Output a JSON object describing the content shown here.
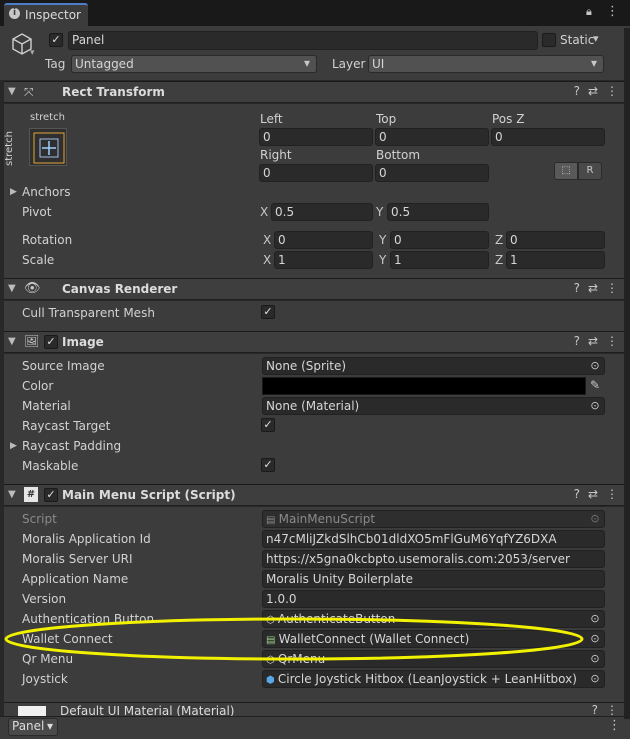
{
  "tab": {
    "title": "Inspector"
  },
  "object": {
    "name": "Panel",
    "static_label": "Static",
    "tag_label": "Tag",
    "tag_value": "Untagged",
    "layer_label": "Layer",
    "layer_value": "UI"
  },
  "rect_transform": {
    "title": "Rect Transform",
    "stretch_top": "stretch",
    "stretch_side": "stretch",
    "left_label": "Left",
    "left": "0",
    "top_label": "Top",
    "top": "0",
    "posz_label": "Pos Z",
    "posz": "0",
    "right_label": "Right",
    "right": "0",
    "bottom_label": "Bottom",
    "bottom": "0",
    "r_button": "R",
    "anchors_label": "Anchors",
    "pivot_label": "Pivot",
    "pivot_x": "0.5",
    "pivot_y": "0.5",
    "rotation_label": "Rotation",
    "rot_x": "0",
    "rot_y": "0",
    "rot_z": "0",
    "scale_label": "Scale",
    "scale_x": "1",
    "scale_y": "1",
    "scale_z": "1",
    "x": "X",
    "y": "Y",
    "z": "Z"
  },
  "canvas_renderer": {
    "title": "Canvas Renderer",
    "cull_label": "Cull Transparent Mesh"
  },
  "image": {
    "title": "Image",
    "source_label": "Source Image",
    "source_value": "None (Sprite)",
    "color_label": "Color",
    "material_label": "Material",
    "material_value": "None (Material)",
    "raycast_target_label": "Raycast Target",
    "raycast_padding_label": "Raycast Padding",
    "maskable_label": "Maskable"
  },
  "script": {
    "title": "Main Menu Script (Script)",
    "script_label": "Script",
    "script_value": "MainMenuScript",
    "app_id_label": "Moralis Application Id",
    "app_id_value": "n47cMliJZkdSlhCb01dldXO5mFlGuM6YqfYZ6DXA",
    "server_label": "Moralis Server URI",
    "server_value": "https://x5gna0kcbpto.usemoralis.com:2053/server",
    "app_name_label": "Application Name",
    "app_name_value": "Moralis Unity Boilerplate",
    "version_label": "Version",
    "version_value": "1.0.0",
    "auth_label": "Authentication Button",
    "auth_value": "AuthenticateButton",
    "wallet_label": "Wallet Connect",
    "wallet_value": "WalletConnect (Wallet Connect)",
    "qr_label": "Qr Menu",
    "qr_value": "QrMenu",
    "joystick_label": "Joystick",
    "joystick_value": "Circle Joystick Hitbox (LeanJoystick + LeanHitbox)"
  },
  "default_material": {
    "title": "Default UI Material (Material)"
  },
  "footer": {
    "label": "Panel"
  },
  "colors": {
    "highlight": "#f2f200",
    "color_swatch": "#000000"
  }
}
